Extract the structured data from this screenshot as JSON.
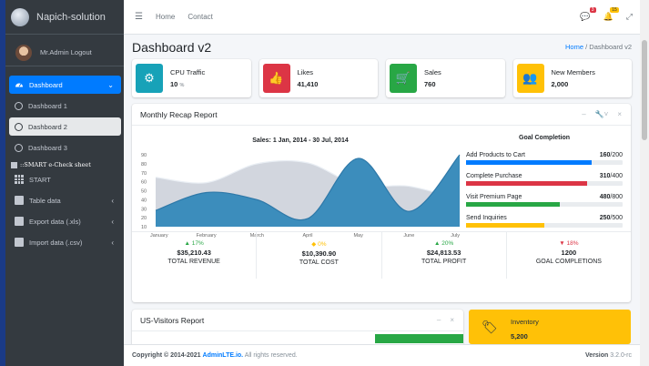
{
  "brand": {
    "name": "Napich-solution"
  },
  "user": {
    "label": "Mr.Admin Logout"
  },
  "sidebar": {
    "items": [
      {
        "label": "Dashboard"
      },
      {
        "label": "Dashboard 1"
      },
      {
        "label": "Dashboard 2"
      },
      {
        "label": "Dashboard 3"
      }
    ],
    "section": "::SMART e-Check sheet",
    "links": [
      {
        "label": "START"
      },
      {
        "label": "Table data"
      },
      {
        "label": "Export data (.xls)"
      },
      {
        "label": "Import data (.csv)"
      }
    ]
  },
  "topnav": {
    "home": "Home",
    "contact": "Contact",
    "messages_badge": "3",
    "notifications_badge": "15"
  },
  "page": {
    "title": "Dashboard v2",
    "breadcrumb_home": "Home",
    "breadcrumb_sep": "/",
    "breadcrumb_current": "Dashboard v2"
  },
  "info_boxes": [
    {
      "label": "CPU Traffic",
      "value": "10",
      "unit": "%",
      "color": "#17a2b8",
      "icon": "gear-icon"
    },
    {
      "label": "Likes",
      "value": "41,410",
      "color": "#dc3545",
      "icon": "thumbs-up-icon"
    },
    {
      "label": "Sales",
      "value": "760",
      "color": "#28a745",
      "icon": "shopping-cart-icon"
    },
    {
      "label": "New Members",
      "value": "2,000",
      "color": "#ffc107",
      "icon": "users-icon"
    }
  ],
  "recap": {
    "title": "Monthly Recap Report",
    "chart_title": "Sales: 1 Jan, 2014 - 30 Jul, 2014",
    "goal_title": "Goal Completion",
    "goals": [
      {
        "label": "Add Products to Cart",
        "value": "160",
        "total": "/200",
        "pct": 0.8,
        "color": "#007bff"
      },
      {
        "label": "Complete Purchase",
        "value": "310",
        "total": "/400",
        "pct": 0.775,
        "color": "#dc3545"
      },
      {
        "label": "Visit Premium Page",
        "value": "480",
        "total": "/800",
        "pct": 0.6,
        "color": "#28a745"
      },
      {
        "label": "Send Inquiries",
        "value": "250",
        "total": "/500",
        "pct": 0.5,
        "color": "#ffc107"
      }
    ],
    "stats": [
      {
        "pct": "17%",
        "dir": "up",
        "color": "#28a745",
        "value": "$35,210.43",
        "label": "TOTAL REVENUE"
      },
      {
        "pct": "0%",
        "dir": "flat",
        "color": "#ffc107",
        "value": "$10,390.90",
        "label": "TOTAL COST"
      },
      {
        "pct": "20%",
        "dir": "up",
        "color": "#28a745",
        "value": "$24,813.53",
        "label": "TOTAL PROFIT"
      },
      {
        "pct": "18%",
        "dir": "down",
        "color": "#dc3545",
        "value": "1200",
        "label": "GOAL COMPLETIONS"
      }
    ]
  },
  "chart_data": {
    "type": "area",
    "title": "Sales: 1 Jan, 2014 - 30 Jul, 2014",
    "categories": [
      "January",
      "February",
      "March",
      "April",
      "May",
      "June",
      "July"
    ],
    "ylim": [
      10,
      90
    ],
    "yticks": [
      "90",
      "80",
      "70",
      "60",
      "50",
      "40",
      "30",
      "20",
      "10"
    ],
    "series": [
      {
        "values": [
          28,
          48,
          40,
          19,
          86,
          27,
          90
        ],
        "color": "#3c8dbc"
      },
      {
        "values": [
          65,
          59,
          80,
          81,
          56,
          55,
          40
        ],
        "color": "#d2d6de"
      }
    ]
  },
  "visitors": {
    "title": "US-Visitors Report"
  },
  "inventory": {
    "label": "Inventory",
    "value": "5,200"
  },
  "footer": {
    "copyright": "Copyright © 2014-2021",
    "brand": "AdminLTE.io.",
    "rights": "All rights reserved.",
    "version_label": "Version",
    "version": "3.2.0-rc"
  }
}
